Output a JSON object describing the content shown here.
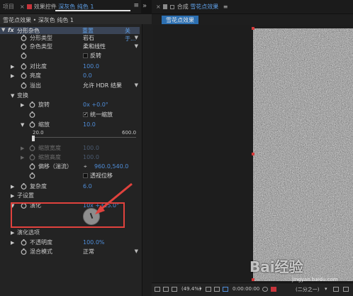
{
  "left_panel": {
    "tab_project": "项目",
    "tab_effects_prefix": "效果控件",
    "tab_effects_layer": "深灰色 纯色 1",
    "breadcrumb_comp": "雪花点效果",
    "breadcrumb_layer": "深灰色 纯色 1",
    "effect": {
      "fx_badge": "fx",
      "name": "分形杂色",
      "reset": "重置",
      "about": "关于..."
    },
    "props": {
      "fractal_type": {
        "label": "分形类型",
        "value": "岩石"
      },
      "noise_type": {
        "label": "杂色类型",
        "value": "柔和线性"
      },
      "invert": {
        "label": "反转"
      },
      "contrast": {
        "label": "对比度",
        "value": "100.0"
      },
      "brightness": {
        "label": "亮度",
        "value": "0.0"
      },
      "overflow": {
        "label": "溢出",
        "value": "允许 HDR 结果"
      },
      "transform": {
        "label": "变换"
      },
      "rotation": {
        "label": "旋转",
        "value": "0x +0.0°"
      },
      "uniform_scale": {
        "label": "统一缩放"
      },
      "scale": {
        "label": "缩放",
        "value": "10.0",
        "min": "20.0",
        "max": "600.0"
      },
      "scale_width": {
        "label": "缩放宽度",
        "value": "100.0"
      },
      "scale_height": {
        "label": "缩放高度",
        "value": "100.0"
      },
      "offset": {
        "label": "偏移（湍流）",
        "value": "960.0,540.0"
      },
      "perspective_offset": {
        "label": "透视位移"
      },
      "complexity": {
        "label": "复杂度",
        "value": "6.0"
      },
      "sub_settings": {
        "label": "子设置"
      },
      "evolution": {
        "label": "演化",
        "value": "10x +315.0°"
      },
      "evolution_options": {
        "label": "演化选项"
      },
      "opacity": {
        "label": "不透明度",
        "value": "100.0%"
      },
      "blend_mode": {
        "label": "混合模式",
        "value": "正常"
      }
    }
  },
  "right_panel": {
    "tab_prefix": "合成",
    "tab_comp": "雪花点效果",
    "comp_subtab": "雪花点效果",
    "bottom_bar": {
      "zoom": "(49.4%)",
      "timecode": "0:00:00:00",
      "resolution": "(二分之一)"
    }
  },
  "watermark": {
    "brand": "Bai经验",
    "url": "jingyan.baidu.com"
  },
  "colors": {
    "accent_blue": "#4f8dd8",
    "annotation_red": "#e0423d",
    "label_red": "#c8343b"
  }
}
